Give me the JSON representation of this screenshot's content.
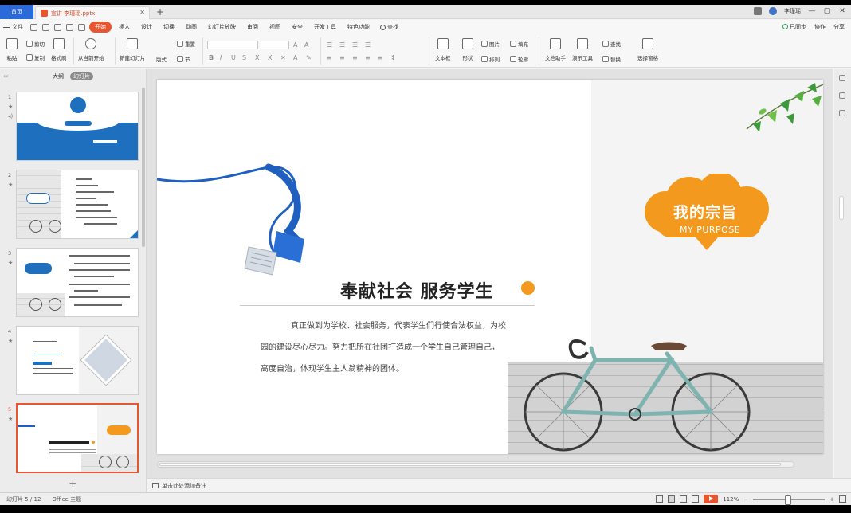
{
  "titlebar": {
    "home_tab": "首页",
    "doc_tab": "宣讲 李瑾瑶.pptx",
    "user": "李瑾瑶"
  },
  "menubar": {
    "file": "文件",
    "tabs": [
      "开始",
      "插入",
      "设计",
      "切换",
      "动画",
      "幻灯片放映",
      "审阅",
      "视图",
      "安全",
      "开发工具",
      "特色功能"
    ],
    "search": "查找",
    "right": [
      "已同步",
      "协作",
      "分享"
    ]
  },
  "ribbon": {
    "paste": "粘贴",
    "cut": "剪切",
    "copy": "复制",
    "format_painter": "格式刷",
    "from_current": "从当前开始",
    "new_slide": "新建幻灯片",
    "layout": "版式",
    "section": "节",
    "reset": "重置",
    "textbox": "文本框",
    "shape": "形状",
    "picture": "图片",
    "fill": "填充",
    "arrange": "排列",
    "outline": "轮廓",
    "text_assistant": "文档助手",
    "presentation_tool": "演示工具",
    "find": "查找",
    "replace": "替换",
    "select_pane": "选择窗格"
  },
  "leftpanel": {
    "tabs": [
      "大纲",
      "幻灯片"
    ],
    "slides": [
      {
        "num": "1"
      },
      {
        "num": "2"
      },
      {
        "num": "3"
      },
      {
        "num": "4"
      },
      {
        "num": "5"
      }
    ]
  },
  "slide": {
    "cloud_title": "我的宗旨",
    "cloud_subtitle": "MY PURPOSE",
    "heading": "奉献社会   服务学生",
    "body": [
      "真正做到为学校、社会服务，代表学生们行使合法权益，为校",
      "园的建设尽心尽力。努力把所在社团打造成一个学生自己管理自己，",
      "高度自治，体现学生主人翁精神的团体。"
    ],
    "colors": {
      "accent": "#f39a1e",
      "plug_blue": "#1f5fbf",
      "leaf_green": "#3c9a3a"
    }
  },
  "notes": {
    "placeholder": "单击此处添加备注"
  },
  "statusbar": {
    "slide_count": "幻灯片 5 / 12",
    "theme": "Office 主题",
    "zoom": "112%"
  }
}
